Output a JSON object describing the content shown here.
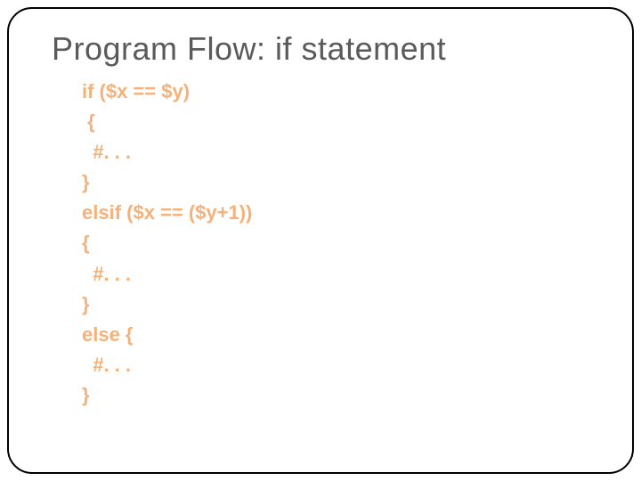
{
  "title": "Program Flow: if statement",
  "code": {
    "lines": [
      "if ($x == $y)",
      " {",
      "  #. . .",
      "}",
      "elsif ($x == ($y+1))",
      "{",
      "  #. . .",
      "}",
      "else {",
      "  #. . .",
      "}"
    ]
  }
}
